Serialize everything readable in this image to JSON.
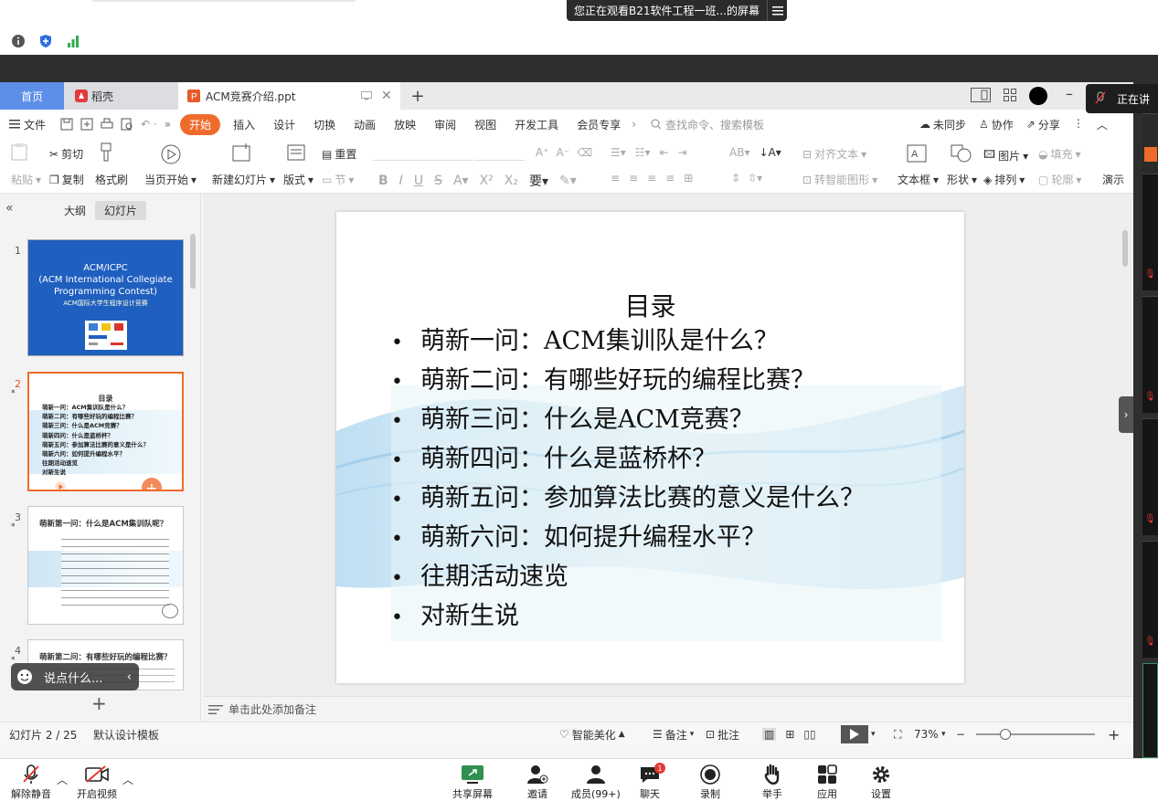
{
  "meeting": {
    "share_notice": "您正在观看B21软件工程一班...的屏幕",
    "speaking_label": "正在讲",
    "toolbar": [
      {
        "key": "mute",
        "label": "解除静音"
      },
      {
        "key": "video",
        "label": "开启视频"
      },
      {
        "key": "share",
        "label": "共享屏幕"
      },
      {
        "key": "invite",
        "label": "邀请"
      },
      {
        "key": "members",
        "label": "成员(99+)"
      },
      {
        "key": "chat",
        "label": "聊天",
        "badge": "1"
      },
      {
        "key": "record",
        "label": "录制"
      },
      {
        "key": "hand",
        "label": "举手"
      },
      {
        "key": "apps",
        "label": "应用"
      },
      {
        "key": "settings",
        "label": "设置"
      }
    ],
    "chat_placeholder": "说点什么..."
  },
  "wps": {
    "tabs": {
      "home": "首页",
      "daoke": "稻壳",
      "doc": "ACM竞赛介绍.ppt"
    },
    "menu": [
      "文件",
      "开始",
      "插入",
      "设计",
      "切换",
      "动画",
      "放映",
      "审阅",
      "视图",
      "开发工具",
      "会员专享"
    ],
    "search_placeholder": "查找命令、搜索模板",
    "menu_right": {
      "sync": "未同步",
      "collab": "协作",
      "share": "分享"
    },
    "ribbon": {
      "paste": "粘贴",
      "cut": "剪切",
      "copy": "复制",
      "format_painter": "格式刷",
      "start_from_current": "当页开始",
      "new_slide": "新建幻灯片",
      "layout": "版式",
      "section": "节",
      "reset": "重置",
      "align_text": "对齐文本",
      "smart_shape": "转智能图形",
      "textbox": "文本框",
      "shape": "形状",
      "picture": "图片",
      "arrange": "排列",
      "fill": "填充",
      "outline": "轮廓",
      "present": "演示"
    },
    "panel": {
      "tab_outline": "大纲",
      "tab_slides": "幻灯片"
    },
    "thumbnails": {
      "s1": {
        "num": "1",
        "line1": "ACM/ICPC",
        "line2": "(ACM International Collegiate",
        "line3": "Programming Contest)",
        "line4": "ACM国际大学生程序设计竞赛"
      },
      "s2": {
        "num": "2",
        "title": "目录",
        "items": [
          "萌新一问：ACM集训队是什么？",
          "萌新二问：有哪些好玩的编程比赛？",
          "萌新三问：什么是ACM竞赛？",
          "萌新四问：什么是蓝桥杯？",
          "萌新五问：参加算法比赛的意义是什么？",
          "萌新六问：如何提升编程水平？",
          "往期活动速览",
          "对新生说"
        ]
      },
      "s3": {
        "num": "3",
        "title": "萌新第一问：什么是ACM集训队呢？"
      },
      "s4": {
        "num": "4",
        "title": "萌新第二问：有哪些好玩的编程比赛？"
      }
    },
    "slide": {
      "title": "目录",
      "items": [
        "萌新一问：ACM集训队是什么？",
        "萌新二问：有哪些好玩的编程比赛？",
        "萌新三问：什么是ACM竞赛？",
        "萌新四问：什么是蓝桥杯？",
        "萌新五问：参加算法比赛的意义是什么？",
        "萌新六问：如何提升编程水平？",
        "往期活动速览",
        "对新生说"
      ]
    },
    "notes_placeholder": "单击此处添加备注",
    "status": {
      "slide_counter": "幻灯片 2 / 25",
      "theme": "默认设计模板",
      "smart_beautify": "智能美化",
      "notes": "备注",
      "comments": "批注",
      "zoom": "73%"
    }
  },
  "colors": {
    "accent_orange": "#ef6b2c",
    "home_tab_blue": "#5d8fe8",
    "slide1_blue": "#1f5fbf"
  }
}
